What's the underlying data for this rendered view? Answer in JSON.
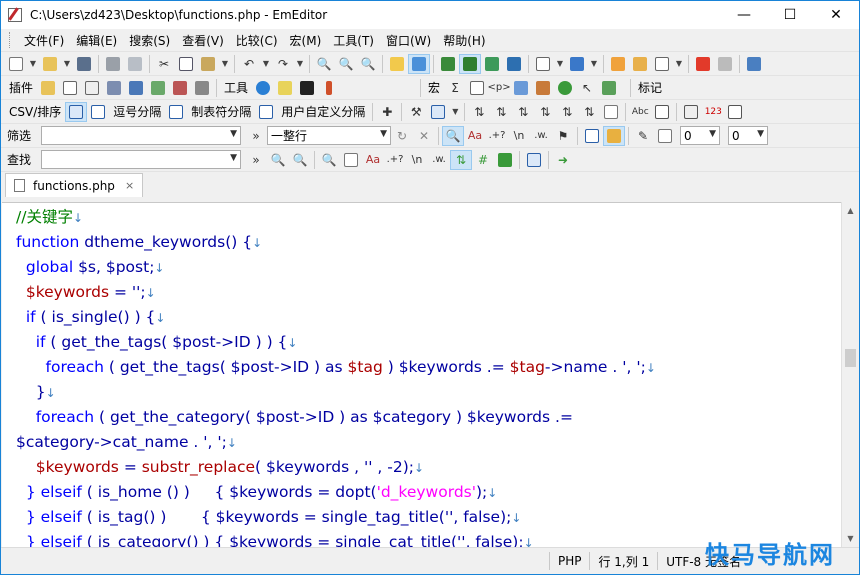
{
  "window": {
    "title": "C:\\Users\\zd423\\Desktop\\functions.php - EmEditor",
    "controls": {
      "minimize": "—",
      "maximize": "☐",
      "close": "✕"
    }
  },
  "menu": [
    "文件(F)",
    "编辑(E)",
    "搜索(S)",
    "查看(V)",
    "比较(C)",
    "宏(M)",
    "工具(T)",
    "窗口(W)",
    "帮助(H)"
  ],
  "toolbars": {
    "plugins_label": "插件",
    "tools_label": "工具",
    "macro_label": "宏",
    "markers_label": "标记",
    "csv_label": "CSV/排序",
    "comma_sep": "逗号分隔",
    "tab_sep": "制表符分隔",
    "user_sep": "用户自定义分隔"
  },
  "filter": {
    "label": "筛选",
    "value": "",
    "mode": "一整行",
    "num1": "0",
    "num2": "0"
  },
  "find": {
    "label": "查找",
    "value": ""
  },
  "tabs": [
    {
      "label": "functions.php",
      "close": "×"
    }
  ],
  "code": {
    "l1": "//关键字",
    "l2a": "function",
    "l2b": " dtheme_keywords() {",
    "l3a": "  global",
    "l3b": " $s, $post;",
    "l4a": "  $keywords",
    "l4b": " = '';",
    "l5a": "  if",
    "l5b": " ( is_single() ) {",
    "l6a": "    if",
    "l6b": " ( get_the_tags( $post->ID ) ) {",
    "l7a": "      foreach",
    "l7b": " ( get_the_tags( $post->ID ) as ",
    "l7c": "$tag",
    "l7d": " ) $keywords .= ",
    "l7e": "$tag",
    "l7f": "->name . ', ';",
    "l8": "    }",
    "l9a": "    foreach",
    "l9b": " ( get_the_category( $post->ID ) as $category ) $keywords .=",
    "l10": "$category->cat_name . ', ';",
    "l11a": "    $keywords",
    "l11b": " = ",
    "l11c": "substr_replace",
    "l11d": "( $keywords , '' , -2);",
    "l12a": "  } elseif",
    "l12b": " ( is_home () )     { $keywords = dopt(",
    "l12c": "'d_keywords'",
    "l12d": ");",
    "l13a": "  } elseif",
    "l13b": " ( is_tag() )       { $keywords = single_tag_title('', false);",
    "l14a": "  } elseif",
    "l14b": " ( is_category() ) { $keywords = single_cat_title('', false);",
    "eol": "↓"
  },
  "status": {
    "lang": "PHP",
    "position": "行 1,列 1",
    "encoding": "UTF-8 无签名"
  },
  "watermark": "快马导航网",
  "colors": {
    "keyword": "#0000ff",
    "comment": "#008000",
    "string": "#ff00ff"
  }
}
